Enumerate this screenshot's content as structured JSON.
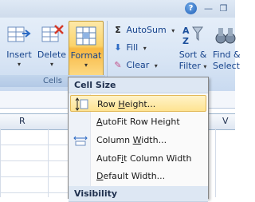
{
  "ribbon": {
    "help_icon": "help-icon",
    "cells_group": {
      "label": "Cells",
      "insert_label": "Insert",
      "delete_label": "Delete",
      "format_label": "Format"
    },
    "editing_group": {
      "autosum_label": "AutoSum",
      "fill_label": "Fill",
      "clear_label": "Clear",
      "sort_label": "Sort &",
      "filter_label": "Filter",
      "find_label": "Find &",
      "select_label": "Select"
    }
  },
  "sheet": {
    "col_r": "R",
    "col_v": "V"
  },
  "format_menu": {
    "cell_size_header": "Cell Size",
    "row_height": {
      "pre": "Row ",
      "u": "H",
      "post": "eight..."
    },
    "autofit_row": {
      "pre": "",
      "u": "A",
      "post": "utoFit Row Height"
    },
    "column_width": {
      "pre": "Column ",
      "u": "W",
      "post": "idth..."
    },
    "autofit_column": {
      "pre": "AutoF",
      "u": "i",
      "post": "t Column Width"
    },
    "default_width": {
      "pre": "",
      "u": "D",
      "post": "efault Width..."
    },
    "visibility_header": "Visibility"
  },
  "colors": {
    "ribbon_bg": "#d7e4f4",
    "highlight": "#fee391",
    "text_blue": "#15428b"
  }
}
